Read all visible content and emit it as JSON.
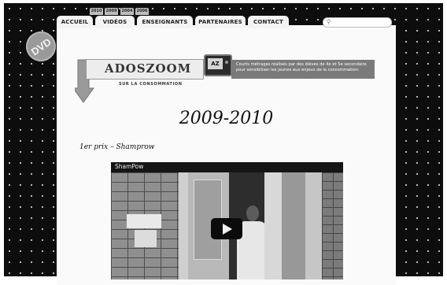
{
  "nav": {
    "tabs": [
      "ACCUEIL",
      "VIDÉOS",
      "ENSEIGNANTS",
      "PARTENAIRES",
      "CONTACT"
    ],
    "years": [
      "2010",
      "2009",
      "2004",
      "2006"
    ]
  },
  "search": {
    "placeholder": ""
  },
  "dvd_badge": "DVD",
  "brand": {
    "logo": "ADOSZOOM",
    "subtitle": "SUR LA CONSOMMATION",
    "tv_label": "AZ",
    "tagline_line1": "Courts métrages réalisés par des élèves de 4e et 5e secondaire",
    "tagline_line2": "pour sensibiliser les jeunes aux enjeux de la consommation."
  },
  "content": {
    "season": "2009-2010",
    "prize": "1er prix – Shamprow"
  },
  "video": {
    "title": "ShamPow"
  },
  "colors": {
    "background": "#0d0d0d",
    "page": "#fafafa",
    "accent": "#7a7a7a"
  }
}
